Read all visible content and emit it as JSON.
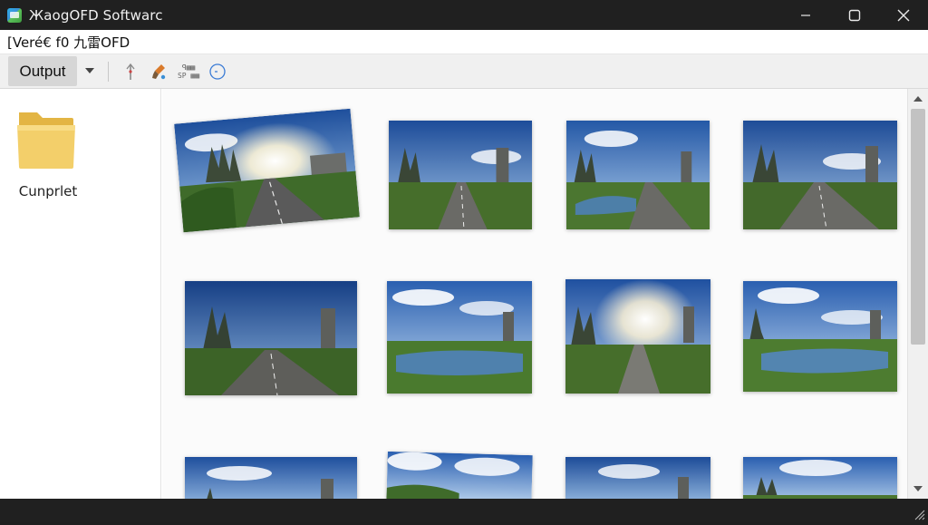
{
  "window": {
    "title": "ЖaogOFD Softwarc",
    "controls": [
      "minimize",
      "maximize",
      "close"
    ]
  },
  "pathbar": {
    "text": "[Veré€ f0 九雷OFD"
  },
  "toolbar": {
    "output_label": "Output",
    "icons": [
      "dropdown-arrow-icon",
      "pin-icon",
      "brush-icon",
      "grid-info-icon",
      "clock-icon"
    ],
    "mini_icon_text_top": "ꟼ▦▦",
    "mini_icon_text_bottom": "SP ▦▦"
  },
  "left_pane": {
    "folder_label": "Cunprlet",
    "folder_color": "#f3cf6a"
  },
  "thumbnails": {
    "count_visible": 12,
    "variants": [
      "road-sunburst",
      "road-river",
      "road-plain",
      "river-view"
    ]
  },
  "colors": {
    "titlebar": "#202020",
    "toolbar": "#f0f0f0",
    "accent": "#3a8fd6"
  }
}
